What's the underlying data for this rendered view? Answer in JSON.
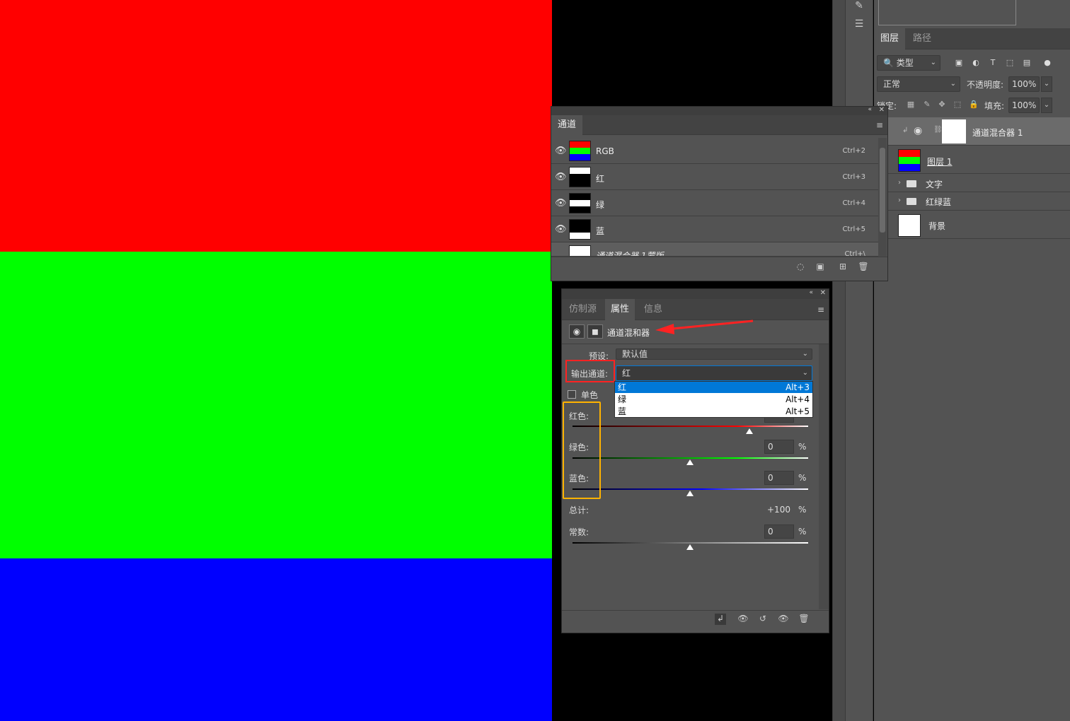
{
  "channels_panel": {
    "tab": "通道",
    "rows": [
      {
        "name": "RGB",
        "shortcut": "Ctrl+2"
      },
      {
        "name": "红",
        "shortcut": "Ctrl+3"
      },
      {
        "name": "绿",
        "shortcut": "Ctrl+4"
      },
      {
        "name": "蓝",
        "shortcut": "Ctrl+5"
      },
      {
        "name": "通道混合器 1蒙版",
        "shortcut": "Ctrl+\\"
      }
    ]
  },
  "layers_panel": {
    "tabs": [
      "图层",
      "路径"
    ],
    "filter_label": "类型",
    "blend_mode": "正常",
    "opacity_label": "不透明度:",
    "opacity_value": "100%",
    "lock_label": "锁定:",
    "fill_label": "填充:",
    "fill_value": "100%",
    "layers": [
      {
        "name": "通道混合器 1"
      },
      {
        "name": "图层 1"
      },
      {
        "name": "文字"
      },
      {
        "name": "红绿蓝"
      },
      {
        "name": "背景"
      }
    ]
  },
  "properties_panel": {
    "tabs": [
      "仿制源",
      "属性",
      "信息"
    ],
    "title": "通道混和器",
    "preset_label": "预设:",
    "preset_value": "默认值",
    "output_label": "输出通道:",
    "output_value": "红",
    "mono_label": "单色",
    "mono_checked": false,
    "dropdown_options": [
      {
        "label": "红",
        "shortcut": "Alt+3",
        "selected": true
      },
      {
        "label": "绿",
        "shortcut": "Alt+4",
        "selected": false
      },
      {
        "label": "蓝",
        "shortcut": "Alt+5",
        "selected": false
      }
    ],
    "red_label": "红色:",
    "red_value": 100,
    "green_label": "绿色:",
    "green_value": "0",
    "green_unit": "%",
    "blue_label": "蓝色:",
    "blue_value": "0",
    "blue_unit": "%",
    "total_label": "总计:",
    "total_value": "+100",
    "total_unit": "%",
    "constant_label": "常数:",
    "constant_value": "0",
    "constant_unit": "%"
  },
  "colors": {
    "accent_blue": "#0078d7",
    "annotation_red": "#ff2222",
    "annotation_yellow": "#ffb300"
  }
}
